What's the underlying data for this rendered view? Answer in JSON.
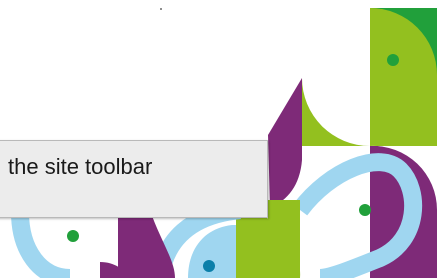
{
  "tooltip": {
    "text": "the site toolbar"
  },
  "colors": {
    "purple": "#7e2a78",
    "lime": "#93c01f",
    "green": "#21a03b",
    "sky_blue": "#9fd6f0",
    "teal": "#0b7fa9",
    "tooltip_bg": "#ececec",
    "tooltip_border": "#b9b9b9"
  }
}
